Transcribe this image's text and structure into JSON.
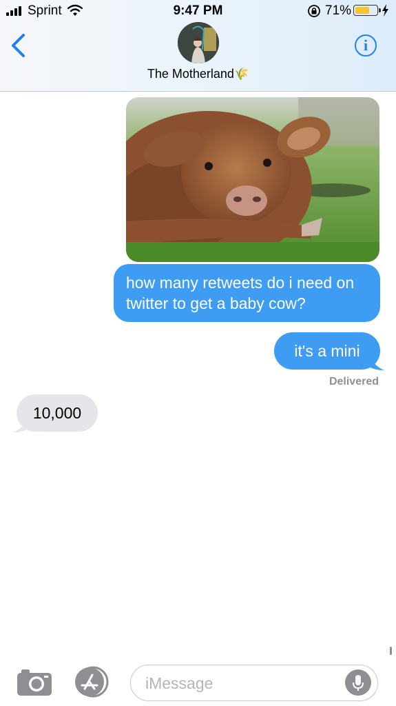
{
  "status_bar": {
    "carrier": "Sprint",
    "time": "9:47 PM",
    "battery_percent": "71%",
    "battery_level": 0.71,
    "icons": [
      "signal-icon",
      "wifi-icon",
      "orientation-lock-icon",
      "battery-icon",
      "charging-bolt-icon"
    ]
  },
  "header": {
    "contact_name": "The Motherland",
    "contact_emoji": "🌾",
    "back_icon": "chevron-left-icon",
    "info_label": "i"
  },
  "messages": [
    {
      "type": "image",
      "direction": "sent",
      "subject": "highland calf lying in grass"
    },
    {
      "type": "text",
      "direction": "sent",
      "text": "how many retweets do i need on twitter to get a baby cow?"
    },
    {
      "type": "text",
      "direction": "sent",
      "text": "it's a mini"
    },
    {
      "type": "text",
      "direction": "received",
      "text": "10,000"
    }
  ],
  "delivery_status": "Delivered",
  "input_bar": {
    "placeholder": "iMessage",
    "icons": [
      "camera-icon",
      "app-store-icon",
      "microphone-icon"
    ]
  },
  "colors": {
    "sent_bubble": "#3e9cf2",
    "received_bubble": "#e6e6ea",
    "accent": "#1f7ff5",
    "battery_fill": "#f6c632"
  }
}
